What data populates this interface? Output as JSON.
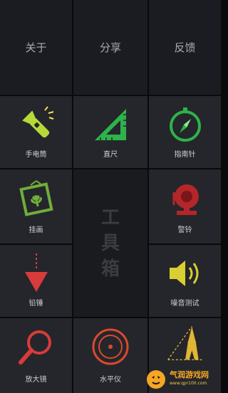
{
  "menu": {
    "about_label": "关于",
    "share_label": "分享",
    "feedback_label": "反馈"
  },
  "tools": [
    {
      "label": "手电筒",
      "icon": "flashlight-icon",
      "color": "#b8d93a"
    },
    {
      "label": "直尺",
      "icon": "ruler-triangle-icon",
      "color": "#2db34a"
    },
    {
      "label": "指南针",
      "icon": "compass-icon",
      "color": "#2db34a"
    },
    {
      "label": "挂画",
      "icon": "picture-frame-icon",
      "color": "#6fae3a"
    },
    {
      "label": "警铃",
      "icon": "alarm-bell-icon",
      "color": "#b3262a"
    },
    {
      "label": "铅锤",
      "icon": "plumb-bob-icon",
      "color": "#d93b3b"
    },
    {
      "label": "噪音测试",
      "icon": "speaker-icon",
      "color": "#d8cf32"
    },
    {
      "label": "放大镜",
      "icon": "magnifier-icon",
      "color": "#d93b3b"
    },
    {
      "label": "水平仪",
      "icon": "level-icon",
      "color": "#d94a2f"
    },
    {
      "label": "",
      "icon": "tower-measure-icon",
      "color": "#e0b634"
    }
  ],
  "banner": {
    "chars": [
      "工",
      "具",
      "箱"
    ]
  },
  "watermark": {
    "main": "气润游戏网",
    "sub": "www.qpr100.com",
    "logo_icon": "tiger-logo-icon"
  },
  "colors": {
    "background": "#0a0a0c",
    "tile": "#25262b",
    "top_tile": "#1b1c21",
    "center": "#1a1b1e"
  }
}
